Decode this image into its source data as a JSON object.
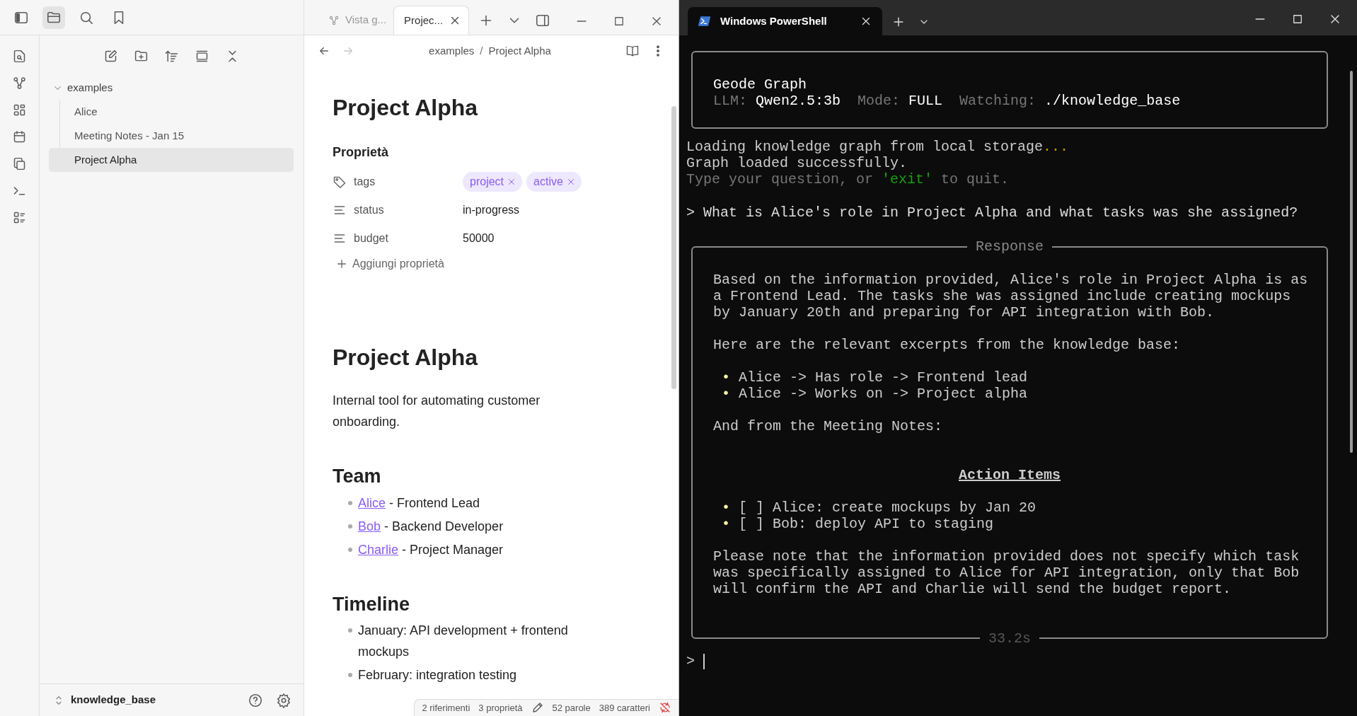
{
  "notes_app": {
    "tabs": [
      {
        "label": "Vista g...",
        "selected": false,
        "kind": "graph"
      },
      {
        "label": "Projec...",
        "selected": true,
        "kind": "note"
      }
    ],
    "breadcrumb": {
      "items": [
        "examples",
        "Project Alpha"
      ],
      "separator": "/"
    },
    "tree": [
      {
        "label": "examples",
        "expanded": true,
        "children": [
          {
            "label": "Alice",
            "selected": false
          },
          {
            "label": "Meeting Notes - Jan 15",
            "selected": false
          },
          {
            "label": "Project Alpha",
            "selected": true
          }
        ]
      }
    ],
    "vault": "knowledge_base",
    "note": {
      "title": "Project Alpha",
      "properties_heading": "Proprietà",
      "properties": [
        {
          "kind": "tags",
          "key": "tags",
          "tags": [
            "project",
            "active"
          ]
        },
        {
          "kind": "text",
          "key": "status",
          "value": "in-progress"
        },
        {
          "kind": "number",
          "key": "budget",
          "value": "50000"
        }
      ],
      "add_property": "Aggiungi proprietà",
      "body": [
        {
          "kind": "h1",
          "text": "Project Alpha"
        },
        {
          "kind": "paragraph",
          "text": "Internal tool for automating customer onboarding."
        },
        {
          "kind": "h2",
          "text": "Team"
        },
        {
          "kind": "list",
          "items": [
            {
              "link": "Alice",
              "text": " - Frontend Lead"
            },
            {
              "link": "Bob",
              "text": " - Backend Developer"
            },
            {
              "link": "Charlie",
              "text": " - Project Manager"
            }
          ]
        },
        {
          "kind": "h2",
          "text": "Timeline"
        },
        {
          "kind": "list",
          "items": [
            {
              "text": "January: API development + frontend mockups"
            },
            {
              "text": "February: integration testing"
            }
          ]
        }
      ]
    },
    "status_bar": [
      "2 riferimenti",
      "3 proprietà",
      "52 parole",
      "389 caratteri"
    ]
  },
  "terminal": {
    "tab_title": "Windows PowerShell",
    "banner": {
      "title": "Geode Graph",
      "fields": [
        {
          "label": "LLM:",
          "value": "Qwen2.5:3b"
        },
        {
          "label": "Mode:",
          "value": "FULL"
        },
        {
          "label": "Watching:",
          "value": "./knowledge_base"
        }
      ]
    },
    "log": [
      [
        {
          "text": "Loading knowledge graph from local storage",
          "color": "#cccccc"
        },
        {
          "text": "...",
          "color": "#c19c00"
        }
      ],
      [
        {
          "text": "Graph loaded successfully.",
          "color": "#cccccc"
        }
      ],
      [
        {
          "text": "Type your question, or ",
          "color": "#767676"
        },
        {
          "text": "'exit'",
          "color": "#13a10e"
        },
        {
          "text": " to quit.",
          "color": "#767676"
        }
      ]
    ],
    "question": "> What is Alice's role in Project Alpha and what tasks was she assigned?",
    "response": {
      "title": "Response",
      "bullet": "•",
      "blocks": [
        {
          "kind": "paragraph",
          "lines": [
            "Based on the information provided, Alice's role in Project Alpha is as",
            "a Frontend Lead. The tasks she was assigned include creating mockups",
            "by January 20th and preparing for API integration with Bob."
          ]
        },
        {
          "kind": "paragraph",
          "lines": [
            "Here are the relevant excerpts from the knowledge base:"
          ]
        },
        {
          "kind": "bullets",
          "items": [
            "Alice -> Has role -> Frontend lead",
            "Alice -> Works on -> Project alpha"
          ]
        },
        {
          "kind": "paragraph",
          "lines": [
            "And from the Meeting Notes:"
          ]
        },
        {
          "kind": "heading",
          "text": "Action Items"
        },
        {
          "kind": "bullets",
          "items": [
            "[ ] Alice: create mockups by Jan 20",
            "[ ] Bob: deploy API to staging"
          ]
        },
        {
          "kind": "paragraph",
          "lines": [
            "Please note that the information provided does not specify which task",
            "was specifically assigned to Alice for API integration, only that Bob",
            "will confirm the API and Charlie will send the budget report."
          ]
        }
      ],
      "footer": "33.2s"
    },
    "prompt": ">"
  }
}
